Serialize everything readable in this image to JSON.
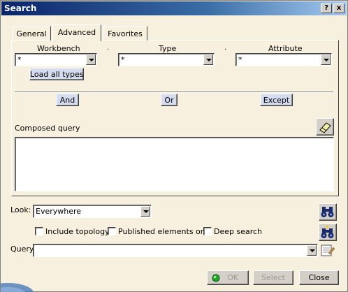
{
  "window": {
    "title": "Search",
    "help_glyph": "?",
    "close_glyph": "x"
  },
  "tabs": [
    {
      "label": "General"
    },
    {
      "label": "Advanced"
    },
    {
      "label": "Favorites"
    }
  ],
  "advanced": {
    "workbench": {
      "label": "Workbench",
      "value": "*"
    },
    "type": {
      "label": "Type",
      "value": "*"
    },
    "attribute": {
      "label": "Attribute",
      "value": "*"
    },
    "load_all_types": "Load all types",
    "and_label": "And",
    "or_label": "Or",
    "except_label": "Except",
    "composed_query_label": "Composed query",
    "composed_query_value": ""
  },
  "look": {
    "label": "Look:",
    "value": "Everywhere"
  },
  "options": [
    {
      "label": "Include topology",
      "checked": false
    },
    {
      "label": "Published elements only",
      "checked": false
    },
    {
      "label": "Deep search",
      "checked": false
    }
  ],
  "query": {
    "label": "Query:",
    "value": ""
  },
  "footer": {
    "ok_label": "OK",
    "select_label": "Select",
    "close_label": "Close"
  },
  "icons": {
    "eraser": "eraser-icon",
    "search": "binoculars-icon",
    "search_add": "binoculars-add-icon",
    "favorites": "notepad-icon",
    "status": "green-light-icon"
  }
}
